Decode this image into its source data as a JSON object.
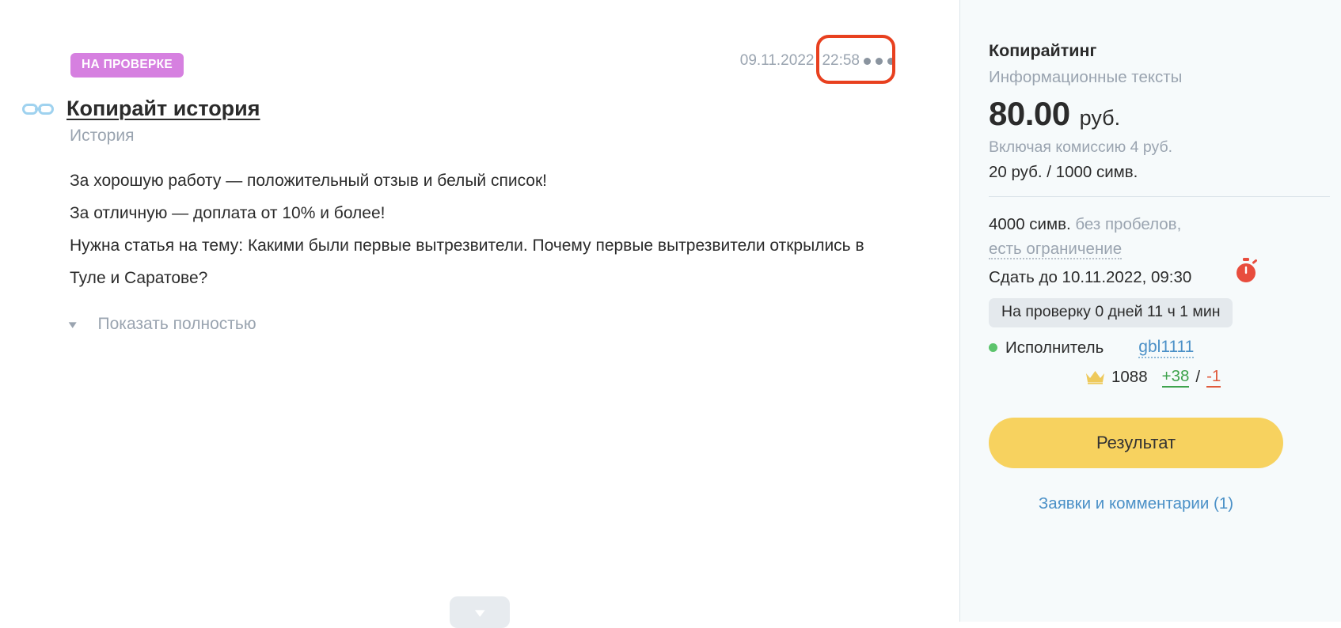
{
  "task": {
    "status_badge": "НА ПРОВЕРКЕ",
    "date": "09.11.2022",
    "time": "22:58",
    "title": "Копирайт история",
    "subtitle": "История",
    "body_lines": [
      "За хорошую работу — положительный отзыв и белый список!",
      "За отличную — доплата от 10% и более!",
      "Нужна статья на тему: Какими были первые вытрезвители. Почему первые вытрезвители открылись в Туле и Саратове?"
    ],
    "show_more_label": "Показать полностью"
  },
  "sidebar": {
    "category": "Копирайтинг",
    "subcategory": "Информационные тексты",
    "price_amount": "80.00",
    "price_currency": "руб.",
    "commission": "Включая комиссию 4 руб.",
    "rate": "20 руб. / 1000 симв.",
    "chars_value": "4000 симв.",
    "chars_note": "без пробелов",
    "chars_comma": ",",
    "limit_link": "есть ограничение",
    "deadline": "Сдать до 10.11.2022, 09:30",
    "review_timer": "На проверку 0 дней 11 ч 1 мин",
    "worker_label": "Исполнитель",
    "worker_name": "gbl1111",
    "rating_value": "1088",
    "rating_positive": "+38",
    "rating_separator": "/",
    "rating_negative": "-1",
    "result_button": "Результат",
    "comments_link": "Заявки и комментарии (1)"
  },
  "colors": {
    "badge": "#d680e0",
    "accent_button": "#f7d25f",
    "link": "#4a90c7",
    "positive": "#3fa34d",
    "negative": "#e05a3c",
    "online_dot": "#5cc46c",
    "annotation": "#e8401f",
    "sidebar_bg": "#f6fafb"
  }
}
